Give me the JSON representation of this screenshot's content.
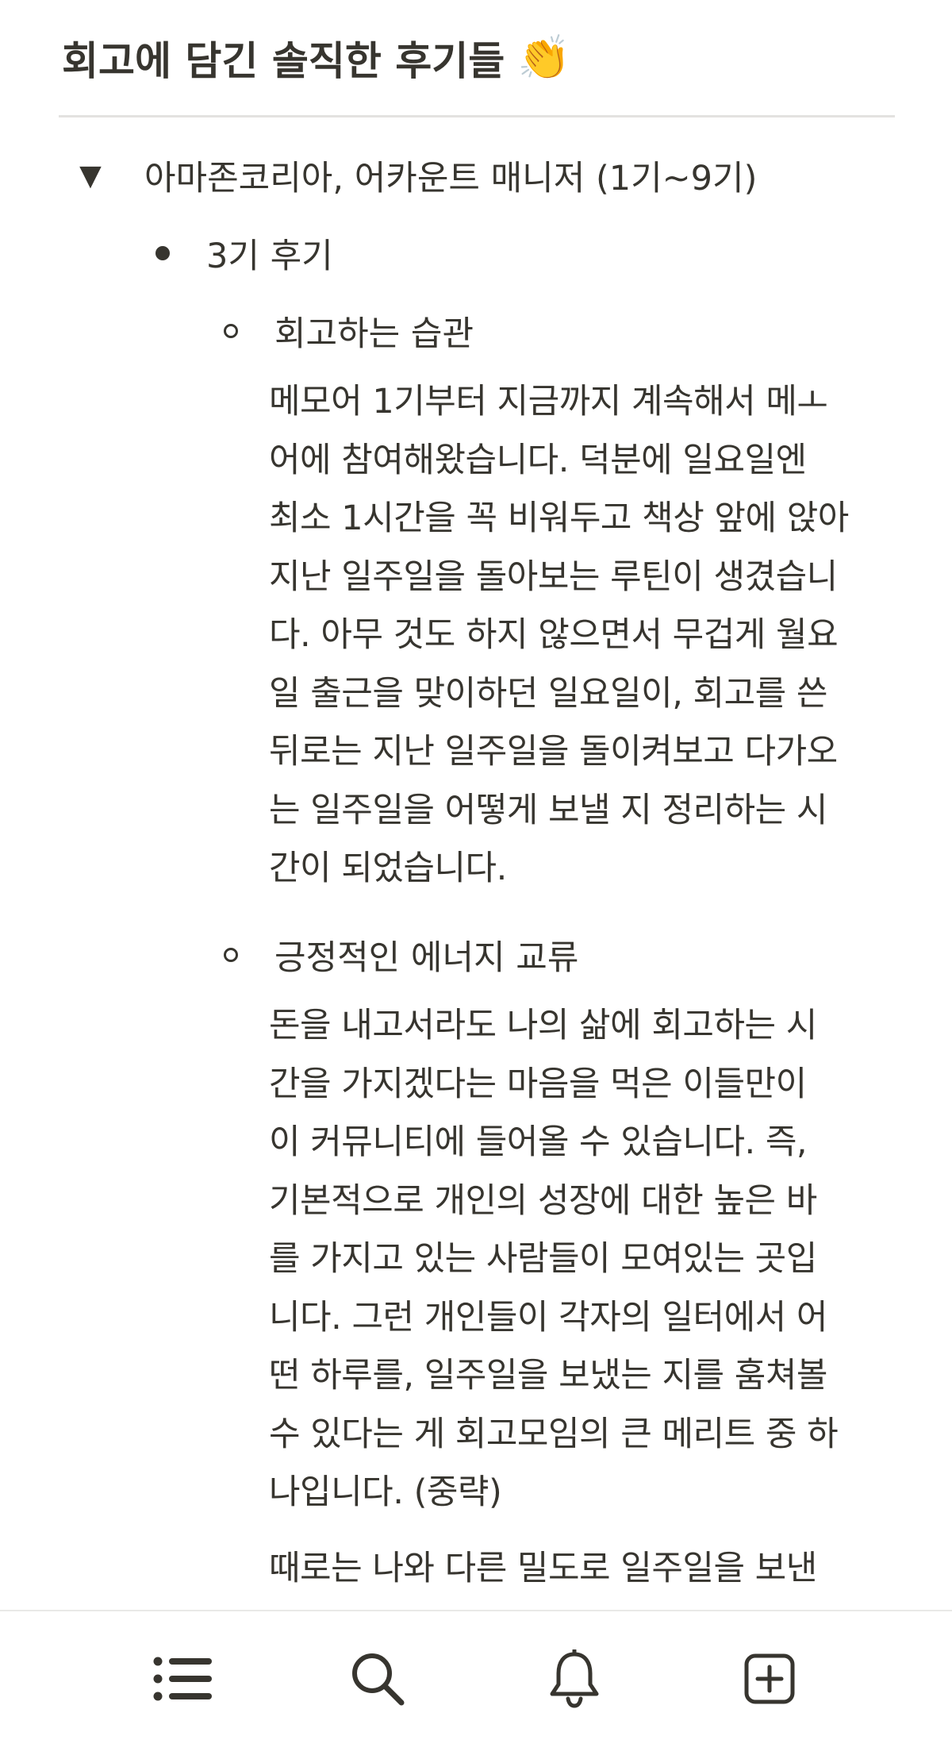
{
  "page": {
    "title": "회고에 담긴 솔직한 후기들",
    "title_emoji": "👏"
  },
  "toggle": {
    "label": "아마존코리아, 어카운트 매니저 (1기~9기)"
  },
  "bullet": {
    "label": "3기 후기"
  },
  "sections": [
    {
      "heading": "회고하는 습관",
      "paragraphs": [
        [
          "메모어 1기부터 지금까지 계속해서 메ㅗ",
          "어에 참여해왔습니다. 덕분에 일요일엔",
          "최소 1시간을 꼭 비워두고 책상 앞에 앉아",
          "지난 일주일을 돌아보는 루틴이 생겼습니",
          "다. 아무 것도 하지 않으면서 무겁게 월요",
          "일 출근을 맞이하던 일요일이, 회고를 쓴",
          "뒤로는 지난 일주일을 돌이켜보고 다가오",
          "는 일주일을 어떻게 보낼 지 정리하는 시",
          "간이 되었습니다."
        ]
      ]
    },
    {
      "heading": "긍정적인 에너지 교류",
      "paragraphs": [
        [
          "돈을 내고서라도 나의 삶에 회고하는 시",
          "간을 가지겠다는 마음을 먹은 이들만이",
          "이 커뮤니티에 들어올 수 있습니다. 즉,",
          "기본적으로 개인의 성장에 대한 높은 바",
          "를 가지고 있는 사람들이 모여있는 곳입",
          "니다. 그런 개인들이 각자의 일터에서 어",
          "떤 하루를, 일주일을 보냈는 지를 훔쳐볼",
          "수 있다는 게 회고모임의 큰 메리트 중 하",
          "나입니다. (중략)"
        ],
        [
          "때로는 나와 다른 밀도로 일주일을 보낸"
        ]
      ]
    }
  ],
  "bottom_nav": [
    {
      "name": "list-icon",
      "label": "list"
    },
    {
      "name": "search-icon",
      "label": "search"
    },
    {
      "name": "bell-icon",
      "label": "notifications"
    },
    {
      "name": "new-page-icon",
      "label": "new page"
    }
  ],
  "colors": {
    "text": "#37352f",
    "divider": "#e3e2e0",
    "icon": "#37352f"
  }
}
